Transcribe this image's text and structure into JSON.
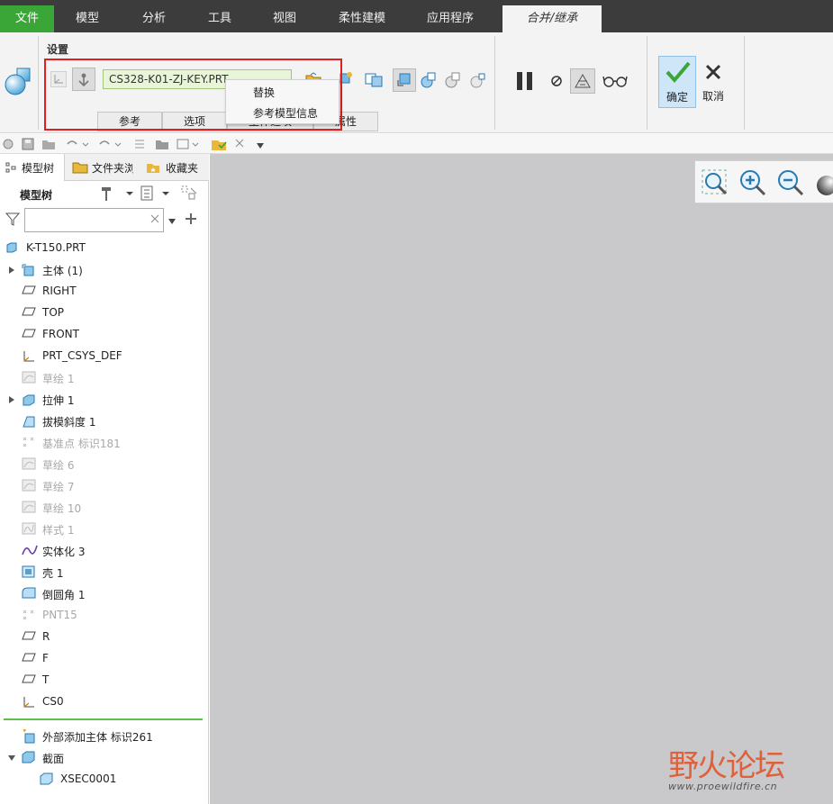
{
  "menubar": {
    "tabs": [
      {
        "label": "文件"
      },
      {
        "label": "模型"
      },
      {
        "label": "分析"
      },
      {
        "label": "工具"
      },
      {
        "label": "视图"
      },
      {
        "label": "柔性建模"
      },
      {
        "label": "应用程序"
      },
      {
        "label": "合并/继承"
      }
    ]
  },
  "ribbon": {
    "group_label": "设置",
    "model_field": "CS328-K01-ZJ-KEY.PRT",
    "subtabs": [
      "参考",
      "选项",
      "主体选项",
      "属性"
    ],
    "context_menu": [
      "替换",
      "参考模型信息"
    ],
    "ok_label": "确定",
    "cancel_label": "取消"
  },
  "leftpanel": {
    "tabs": [
      "模型树",
      "文件夹浏览器",
      "收藏夹"
    ],
    "tree_title": "模型树",
    "search_value": "",
    "tree": [
      {
        "label": "K-T150.PRT",
        "icon": "part-icon",
        "dim": false,
        "expand": false,
        "indent": 0
      },
      {
        "label": "主体 (1)",
        "icon": "body-icon",
        "dim": false,
        "expand": true,
        "indent": 1
      },
      {
        "label": "RIGHT",
        "icon": "datum-plane-icon",
        "dim": false,
        "expand": false,
        "indent": 1
      },
      {
        "label": "TOP",
        "icon": "datum-plane-icon",
        "dim": false,
        "expand": false,
        "indent": 1
      },
      {
        "label": "FRONT",
        "icon": "datum-plane-icon",
        "dim": false,
        "expand": false,
        "indent": 1
      },
      {
        "label": "PRT_CSYS_DEF",
        "icon": "csys-icon",
        "dim": false,
        "expand": false,
        "indent": 1
      },
      {
        "label": "草绘 1",
        "icon": "sketch-icon",
        "dim": true,
        "expand": false,
        "indent": 1
      },
      {
        "label": "拉伸 1",
        "icon": "extrude-icon",
        "dim": false,
        "expand": true,
        "indent": 1
      },
      {
        "label": "拔模斜度 1",
        "icon": "draft-icon",
        "dim": false,
        "expand": false,
        "indent": 1
      },
      {
        "label": "基准点 标识181",
        "icon": "datum-point-icon",
        "dim": true,
        "expand": false,
        "indent": 1
      },
      {
        "label": "草绘 6",
        "icon": "sketch-icon",
        "dim": true,
        "expand": false,
        "indent": 1
      },
      {
        "label": "草绘 7",
        "icon": "sketch-icon",
        "dim": true,
        "expand": false,
        "indent": 1
      },
      {
        "label": "草绘 10",
        "icon": "sketch-icon",
        "dim": true,
        "expand": false,
        "indent": 1
      },
      {
        "label": "样式 1",
        "icon": "style-icon",
        "dim": true,
        "expand": false,
        "indent": 1
      },
      {
        "label": "实体化 3",
        "icon": "solidify-icon",
        "dim": false,
        "expand": false,
        "indent": 1
      },
      {
        "label": "壳 1",
        "icon": "shell-icon",
        "dim": false,
        "expand": false,
        "indent": 1
      },
      {
        "label": "倒圆角 1",
        "icon": "round-icon",
        "dim": false,
        "expand": false,
        "indent": 1
      },
      {
        "label": "PNT15",
        "icon": "datum-point-icon",
        "dim": true,
        "expand": false,
        "indent": 1
      },
      {
        "label": "R",
        "icon": "datum-plane-icon",
        "dim": false,
        "expand": false,
        "indent": 1
      },
      {
        "label": "F",
        "icon": "datum-plane-icon",
        "dim": false,
        "expand": false,
        "indent": 1
      },
      {
        "label": "T",
        "icon": "datum-plane-icon",
        "dim": false,
        "expand": false,
        "indent": 1
      },
      {
        "label": "CS0",
        "icon": "csys-icon",
        "dim": false,
        "expand": false,
        "indent": 1
      }
    ],
    "bottom_tree": [
      {
        "label": "外部添加主体 标识261",
        "icon": "merge-body-icon",
        "expand": false,
        "indent": 1
      },
      {
        "label": "截面",
        "icon": "section-folder-icon",
        "expand": true,
        "indent": 1
      },
      {
        "label": "XSEC0001",
        "icon": "section-icon",
        "expand": false,
        "indent": 2
      }
    ]
  },
  "watermark": {
    "title": "野火论坛",
    "url": "www.proewildfire.cn"
  },
  "colors": {
    "file_tab": "#3aa638",
    "highlight_box": "#e02020",
    "graphics_bg": "#c9c9cc",
    "ok_check": "#3aa638"
  }
}
